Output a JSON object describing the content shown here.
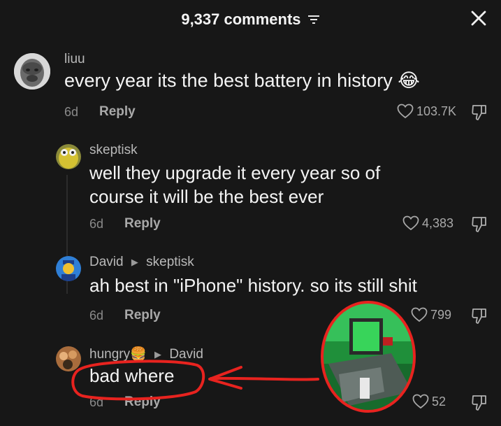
{
  "header": {
    "comment_count": "9,337 comments"
  },
  "comments": [
    {
      "username": "liuu",
      "text": "every year its the best battery in history 😂",
      "time": "6d",
      "reply_label": "Reply",
      "likes": "103.7K"
    },
    {
      "username": "skeptisk",
      "text_line1": "well they upgrade it every year so of",
      "text_line2": "course it will be the best ever",
      "time": "6d",
      "reply_label": "Reply",
      "likes": "4,383"
    },
    {
      "username": "David",
      "reply_to": "skeptisk",
      "text": "ah best in \"iPhone\" history. so its still shit",
      "time": "6d",
      "reply_label": "Reply",
      "likes": "799"
    },
    {
      "username": "hungry🍔",
      "reply_to": "David",
      "text": "bad where",
      "time": "6d",
      "reply_label": "Reply",
      "likes": "52"
    }
  ],
  "colors": {
    "background": "#171717",
    "annotation_red": "#e8231f"
  }
}
